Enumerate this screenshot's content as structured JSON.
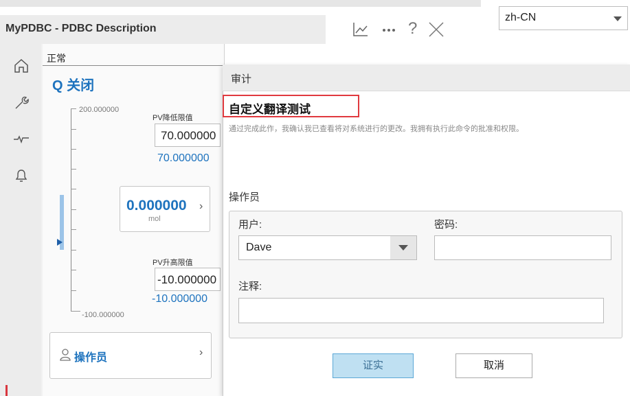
{
  "window": {
    "title": "MyPDBC - PDBC Description",
    "help_glyph": "?"
  },
  "language": {
    "selected": "zh-CN"
  },
  "faceplate": {
    "status": "正常",
    "mode_label": "Q 关闭",
    "scale_max": "200.000000",
    "scale_min": "-100.000000",
    "pv_low_title": "PV降低限值",
    "pv_low_input": "70.000000",
    "pv_low_value": "70.000000",
    "pv_value": "0.000000",
    "pv_unit": "mol",
    "pv_high_title": "PV升高限值",
    "pv_high_input": "-10.000000",
    "pv_high_value": "-10.000000",
    "operator_label": "操作员",
    "chevron": "›"
  },
  "dialog": {
    "title": "审计",
    "heading": "自定义翻译测试",
    "description": "通过完成此作，我确认我已查看将对系统进行的更改。我拥有执行此命令的批准和权限。",
    "section_label": "操作员",
    "user_label": "用户:",
    "user_value": "Dave",
    "password_label": "密码:",
    "password_value": "",
    "comment_label": "注释:",
    "comment_value": "",
    "confirm_label": "证实",
    "cancel_label": "取消"
  }
}
